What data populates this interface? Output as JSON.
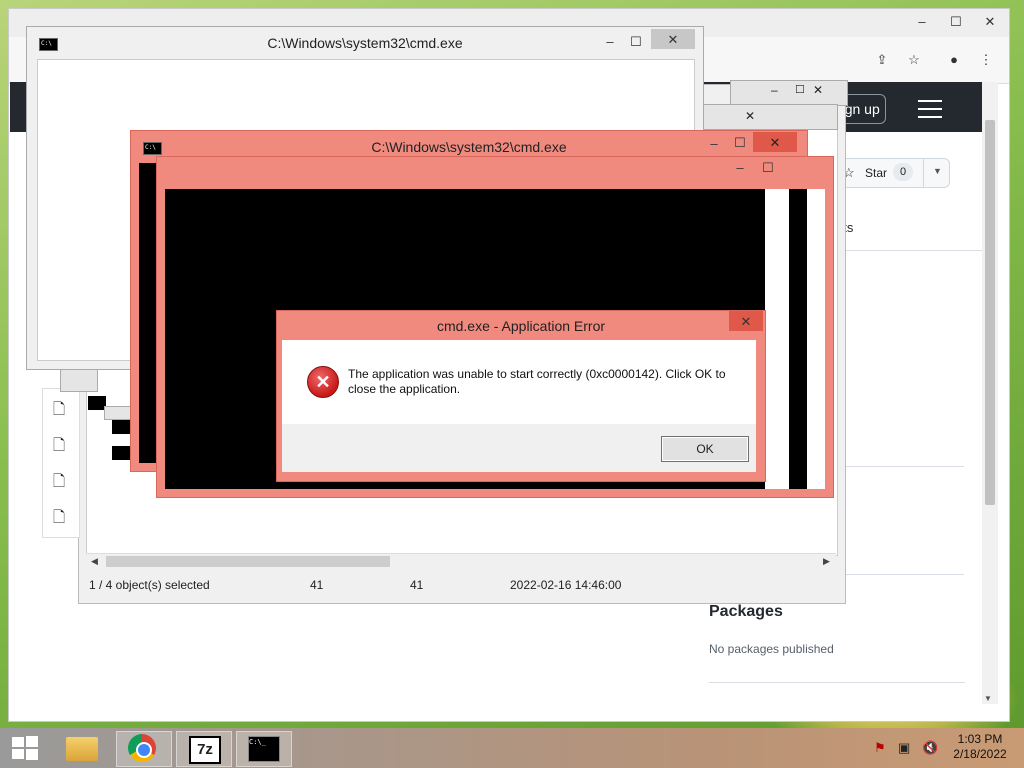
{
  "browser": {
    "signup_label": "Sign up",
    "star_label": "Star",
    "star_count": "0",
    "partial_text": "nts",
    "packages_title": "Packages",
    "packages_empty": "No packages published"
  },
  "file_manager": {
    "status": {
      "selection": "1 / 4 object(s) selected",
      "size": "41",
      "packed_size": "41",
      "modified": "2022-02-16 14:46:00"
    }
  },
  "cmd_windows": {
    "title": "C:\\Windows\\system32\\cmd.exe"
  },
  "error_dialog": {
    "title": "cmd.exe - Application Error",
    "message": "The application was unable to start correctly (0xc0000142). Click OK to close the application.",
    "ok_label": "OK"
  },
  "taskbar": {
    "time": "1:03 PM",
    "date": "2/18/2022",
    "apps": [
      "start-button",
      "file-explorer",
      "chrome",
      "7-zip",
      "cmd"
    ]
  },
  "colors": {
    "error_accent": "#f08a7e",
    "github_header": "#24292f"
  }
}
